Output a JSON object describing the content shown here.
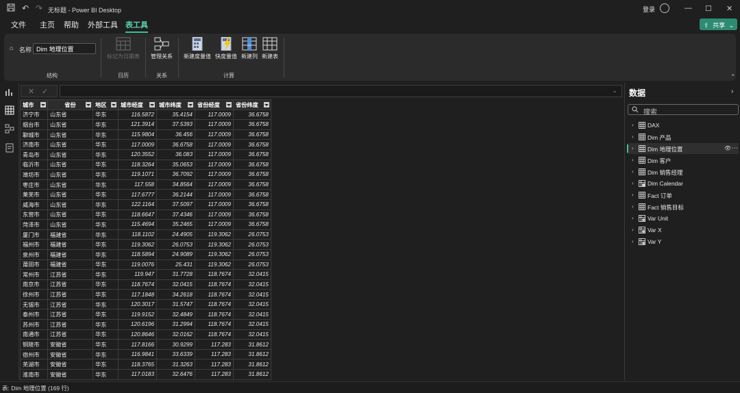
{
  "window": {
    "title": "无标题 - Power BI Desktop",
    "login_label": "登录"
  },
  "menu": {
    "items": [
      "文件",
      "主页",
      "帮助",
      "外部工具",
      "表工具"
    ],
    "active_index": 4
  },
  "share_button": {
    "label": "共享"
  },
  "ribbon": {
    "name_label": "名称",
    "name_value": "Dim 地理位置",
    "buttons": {
      "mark_date_table": "标记为日期表",
      "manage_relationships": "管理关系",
      "new_measure": "新建度量值",
      "quick_measure": "快度量值",
      "new_column": "新建列",
      "new_table": "新建表"
    },
    "groups": {
      "structure": "结构",
      "calendars": "日历",
      "relationships": "关系",
      "calculations": "计算"
    }
  },
  "table": {
    "columns": [
      "城市",
      "省份",
      "地区",
      "城市经度",
      "城市纬度",
      "省份经度",
      "省份纬度"
    ],
    "rows": [
      [
        "济宁市",
        "山东省",
        "华东",
        "116.5872",
        "35.4154",
        "117.0009",
        "36.6758"
      ],
      [
        "烟台市",
        "山东省",
        "华东",
        "121.3914",
        "37.5393",
        "117.0009",
        "36.6758"
      ],
      [
        "聊城市",
        "山东省",
        "华东",
        "115.9804",
        "36.456",
        "117.0009",
        "36.6758"
      ],
      [
        "济南市",
        "山东省",
        "华东",
        "117.0009",
        "36.6758",
        "117.0009",
        "36.6758"
      ],
      [
        "青岛市",
        "山东省",
        "华东",
        "120.3552",
        "36.083",
        "117.0009",
        "36.6758"
      ],
      [
        "临沂市",
        "山东省",
        "华东",
        "118.3264",
        "35.0653",
        "117.0009",
        "36.6758"
      ],
      [
        "潍坊市",
        "山东省",
        "华东",
        "119.1071",
        "36.7092",
        "117.0009",
        "36.6758"
      ],
      [
        "枣庄市",
        "山东省",
        "华东",
        "117.558",
        "34.8564",
        "117.0009",
        "36.6758"
      ],
      [
        "莱芜市",
        "山东省",
        "华东",
        "117.6777",
        "36.2144",
        "117.0009",
        "36.6758"
      ],
      [
        "威海市",
        "山东省",
        "华东",
        "122.1164",
        "37.5097",
        "117.0009",
        "36.6758"
      ],
      [
        "东营市",
        "山东省",
        "华东",
        "118.6647",
        "37.4346",
        "117.0009",
        "36.6758"
      ],
      [
        "菏泽市",
        "山东省",
        "华东",
        "115.4694",
        "35.2465",
        "117.0009",
        "36.6758"
      ],
      [
        "厦门市",
        "福建省",
        "华东",
        "118.1102",
        "24.4905",
        "119.3062",
        "26.0753"
      ],
      [
        "福州市",
        "福建省",
        "华东",
        "119.3062",
        "26.0753",
        "119.3062",
        "26.0753"
      ],
      [
        "泉州市",
        "福建省",
        "华东",
        "118.5894",
        "24.9089",
        "119.3062",
        "26.0753"
      ],
      [
        "莆田市",
        "福建省",
        "华东",
        "119.0076",
        "25.431",
        "119.3062",
        "26.0753"
      ],
      [
        "常州市",
        "江苏省",
        "华东",
        "119.947",
        "31.7728",
        "118.7674",
        "32.0415"
      ],
      [
        "南京市",
        "江苏省",
        "华东",
        "118.7674",
        "32.0415",
        "118.7674",
        "32.0415"
      ],
      [
        "徐州市",
        "江苏省",
        "华东",
        "117.1848",
        "34.2618",
        "118.7674",
        "32.0415"
      ],
      [
        "无锡市",
        "江苏省",
        "华东",
        "120.3017",
        "31.5747",
        "118.7674",
        "32.0415"
      ],
      [
        "泰州市",
        "江苏省",
        "华东",
        "119.9152",
        "32.4849",
        "118.7674",
        "32.0415"
      ],
      [
        "苏州市",
        "江苏省",
        "华东",
        "120.6196",
        "31.2994",
        "118.7674",
        "32.0415"
      ],
      [
        "南通市",
        "江苏省",
        "华东",
        "120.8646",
        "32.0162",
        "118.7674",
        "32.0415"
      ],
      [
        "铜陵市",
        "安徽省",
        "华东",
        "117.8166",
        "30.9299",
        "117.283",
        "31.8612"
      ],
      [
        "宿州市",
        "安徽省",
        "华东",
        "116.9841",
        "33.6339",
        "117.283",
        "31.8612"
      ],
      [
        "芜湖市",
        "安徽省",
        "华东",
        "118.3765",
        "31.3263",
        "117.283",
        "31.8612"
      ],
      [
        "淮南市",
        "安徽省",
        "华东",
        "117.0183",
        "32.6476",
        "117.283",
        "31.8612"
      ]
    ]
  },
  "data_panel": {
    "title": "数据",
    "search_placeholder": "搜索",
    "fields": [
      {
        "name": "DAX",
        "icon": "table-icon"
      },
      {
        "name": "Dim 产品",
        "icon": "table-icon"
      },
      {
        "name": "Dim 地理位置",
        "icon": "table-icon",
        "selected": true
      },
      {
        "name": "Dim 客户",
        "icon": "table-icon"
      },
      {
        "name": "Dim 销售经理",
        "icon": "table-icon"
      },
      {
        "name": "Dim Calendar",
        "icon": "calc-table-icon"
      },
      {
        "name": "Fact 订单",
        "icon": "table-icon"
      },
      {
        "name": "Fact 销售目标",
        "icon": "table-icon"
      },
      {
        "name": "Var Unit",
        "icon": "param-table-icon"
      },
      {
        "name": "Var X",
        "icon": "param-table-icon"
      },
      {
        "name": "Var Y",
        "icon": "param-table-icon"
      }
    ]
  },
  "status_bar": {
    "text": "表: Dim 地理位置 (169 行)"
  }
}
